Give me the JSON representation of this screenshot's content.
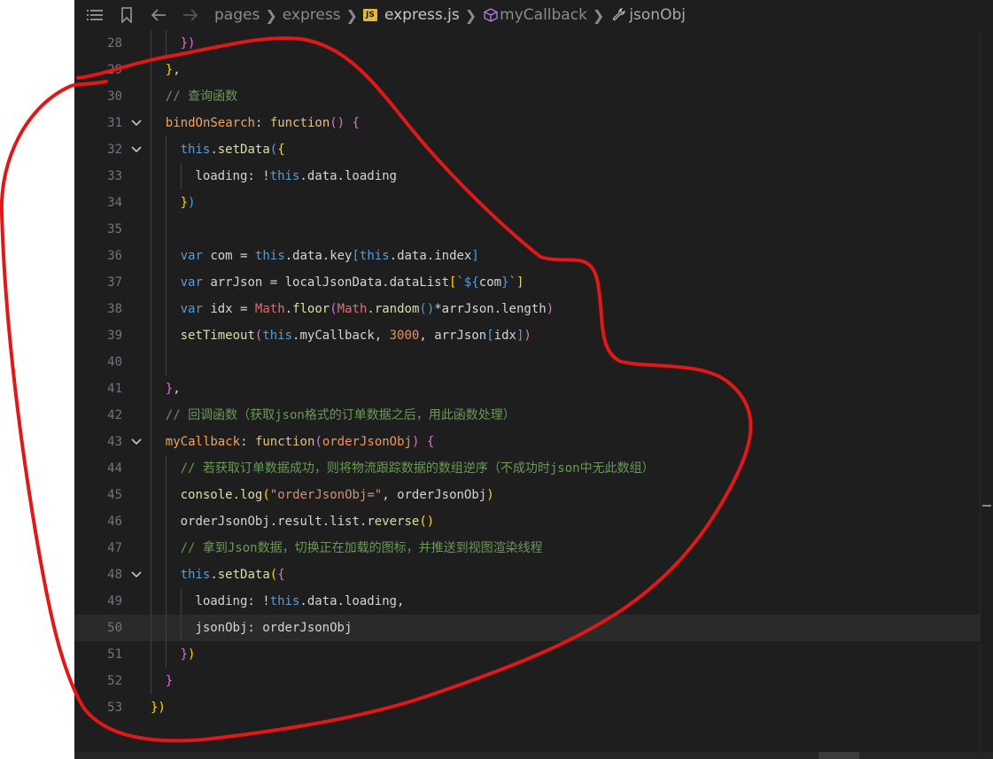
{
  "breadcrumb": {
    "items": [
      "pages",
      "express",
      "express.js",
      "myCallback",
      "jsonObj"
    ],
    "file_badge": "JS"
  },
  "icons": [
    "list-icon",
    "bookmark-icon",
    "back-arrow-icon",
    "forward-arrow-icon",
    "js-file-icon",
    "method-cube-icon",
    "wrench-icon",
    "chevron-down-icon"
  ],
  "lines": [
    {
      "n": "28",
      "fold": false,
      "indent": 2,
      "html": "<span class=\"m\">})</span>"
    },
    {
      "n": "29",
      "fold": false,
      "indent": 1,
      "html": "<span class=\"y\">}</span>,"
    },
    {
      "n": "30",
      "fold": false,
      "indent": 1,
      "html": "<span class=\"c\">// 查询函数</span>"
    },
    {
      "n": "31",
      "fold": true,
      "indent": 1,
      "html": "<span class=\"fo\">bindOnSearch</span>: <span class=\"kw\">function</span><span class=\"m\">()</span> <span class=\"m\">{</span>"
    },
    {
      "n": "32",
      "fold": true,
      "indent": 2,
      "html": "<span class=\"k\">this</span>.<span class=\"f\">setData</span><span class=\"b\">(</span><span class=\"y\">{</span>"
    },
    {
      "n": "33",
      "fold": false,
      "indent": 3,
      "html": "loading: !<span class=\"k\">this</span>.data.loading"
    },
    {
      "n": "34",
      "fold": false,
      "indent": 2,
      "html": "<span class=\"y\">}</span><span class=\"b\">)</span>"
    },
    {
      "n": "35",
      "fold": false,
      "indent": 2,
      "html": ""
    },
    {
      "n": "36",
      "fold": false,
      "indent": 2,
      "html": "<span class=\"k\">var</span> com = <span class=\"k\">this</span>.data.key<span class=\"b\">[</span><span class=\"k\">this</span>.data.index<span class=\"b\">]</span>"
    },
    {
      "n": "37",
      "fold": false,
      "indent": 2,
      "html": "<span class=\"k\">var</span> arrJson = localJsonData.dataList<span class=\"y\">[</span><span class=\"s\">`</span><span class=\"k\">${</span>com<span class=\"k\">}</span><span class=\"s\">`</span><span class=\"y\">]</span>"
    },
    {
      "n": "38",
      "fold": false,
      "indent": 2,
      "html": "<span class=\"k\">var</span> idx = <span class=\"n\">Math</span>.<span class=\"f\">floor</span><span class=\"m\">(</span><span class=\"n\">Math</span>.<span class=\"f\">random</span><span class=\"b\">()</span>*arrJson.length<span class=\"m\">)</span>"
    },
    {
      "n": "39",
      "fold": false,
      "indent": 2,
      "html": "<span class=\"f\">setTimeout</span><span class=\"m\">(</span><span class=\"k\">this</span>.myCallback, <span class=\"num\">3000</span>, arrJson<span class=\"b\">[</span>idx<span class=\"b\">]</span><span class=\"m\">)</span>"
    },
    {
      "n": "40",
      "fold": false,
      "indent": 2,
      "html": ""
    },
    {
      "n": "41",
      "fold": false,
      "indent": 1,
      "html": "<span class=\"m\">}</span>,"
    },
    {
      "n": "42",
      "fold": false,
      "indent": 1,
      "html": "<span class=\"c\">// 回调函数（获取json格式的订单数据之后，用此函数处理）</span>"
    },
    {
      "n": "43",
      "fold": true,
      "indent": 1,
      "html": "<span class=\"fo\">myCallback</span>: <span class=\"kw\">function</span><span class=\"m\">(</span><span class=\"arg\">orderJsonObj</span><span class=\"m\">)</span> <span class=\"m\">{</span>"
    },
    {
      "n": "44",
      "fold": false,
      "indent": 2,
      "html": "<span class=\"c\">// 若获取订单数据成功，则将物流跟踪数据的数组逆序（不成功时json中无此数组）</span>"
    },
    {
      "n": "45",
      "fold": false,
      "indent": 2,
      "html": "<span class=\"f\">console</span>.<span class=\"f\">log</span><span class=\"y\">(</span><span class=\"s\">\"orderJsonObj=\"</span>, orderJsonObj<span class=\"y\">)</span>"
    },
    {
      "n": "46",
      "fold": false,
      "indent": 2,
      "html": "orderJsonObj.result.list.<span class=\"f\">reverse</span><span class=\"y\">()</span>"
    },
    {
      "n": "47",
      "fold": false,
      "indent": 2,
      "html": "<span class=\"c\">// 拿到Json数据，切换正在加载的图标，并推送到视图渲染线程</span>"
    },
    {
      "n": "48",
      "fold": true,
      "indent": 2,
      "html": "<span class=\"k\">this</span>.<span class=\"f\">setData</span><span class=\"y\">(</span><span class=\"m\">{</span>"
    },
    {
      "n": "49",
      "fold": false,
      "indent": 3,
      "html": "loading: !<span class=\"k\">this</span>.data.loading,"
    },
    {
      "n": "50",
      "fold": false,
      "indent": 3,
      "html": "jsonObj: orderJsonObj",
      "highlight": true
    },
    {
      "n": "51",
      "fold": false,
      "indent": 2,
      "html": "<span class=\"m\">}</span><span class=\"y\">)</span>"
    },
    {
      "n": "52",
      "fold": false,
      "indent": 1,
      "html": "<span class=\"m\">}</span>"
    },
    {
      "n": "53",
      "fold": false,
      "indent": 0,
      "html": "<span class=\"y\">})</span>"
    }
  ]
}
